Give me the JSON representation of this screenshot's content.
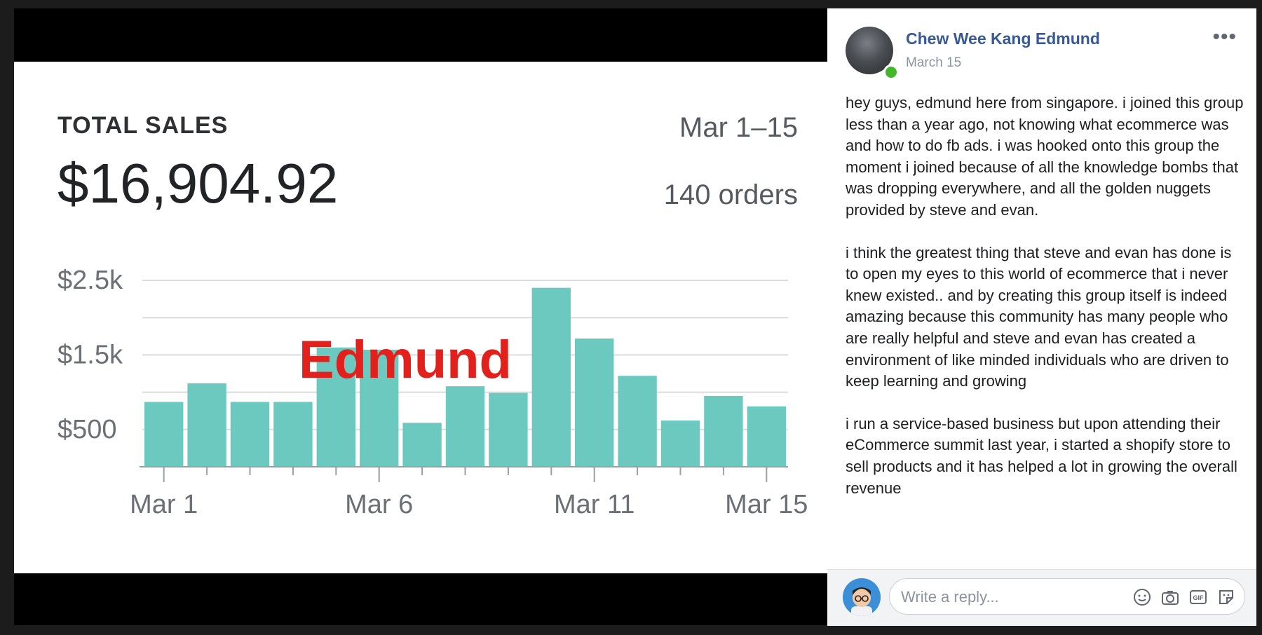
{
  "photo": {
    "label": "TOTAL SALES",
    "date_range": "Mar 1–15",
    "amount": "$16,904.92",
    "orders": "140 orders",
    "watermark": "Edmund"
  },
  "chart_data": {
    "type": "bar",
    "title": "",
    "xlabel": "",
    "ylabel": "",
    "x_tick_labels": [
      "Mar 1",
      "Mar 6",
      "Mar 11",
      "Mar 15"
    ],
    "y_tick_labels": [
      "$2.5k",
      "$1.5k",
      "$500"
    ],
    "categories": [
      "Mar 1",
      "Mar 2",
      "Mar 3",
      "Mar 4",
      "Mar 5",
      "Mar 6",
      "Mar 7",
      "Mar 8",
      "Mar 9",
      "Mar 10",
      "Mar 11",
      "Mar 12",
      "Mar 13",
      "Mar 14",
      "Mar 15"
    ],
    "values": [
      870,
      1120,
      870,
      870,
      1600,
      1570,
      590,
      1080,
      990,
      2400,
      1720,
      1220,
      620,
      950,
      810
    ],
    "ylim": [
      0,
      2500
    ],
    "grid": true,
    "bar_color": "#6cc9c0"
  },
  "post": {
    "author": "Chew Wee Kang Edmund",
    "date": "March 15",
    "more_label": "•••",
    "paragraphs": [
      "hey guys, edmund here from singapore. i joined this group less than a year ago, not knowing what ecommerce was and how to do fb ads. i was hooked onto this group the moment i joined because of all the knowledge bombs that was dropping everywhere, and all the golden nuggets provided by steve and evan.",
      "i think the greatest thing that steve and evan has done is to open my eyes to this world of ecommerce that i never knew existed.. and by creating this group itself is indeed amazing because this community has many people who are really helpful and steve and evan has created a environment of like minded individuals who are driven to keep learning and growing",
      "i run a service-based business but upon attending their eCommerce summit last year, i started a shopify store to sell products and it has helped a lot in growing the overall revenue"
    ]
  },
  "reply": {
    "placeholder": "Write a reply...",
    "icons": [
      "emoji-icon",
      "camera-icon",
      "gif-icon",
      "sticker-icon"
    ]
  },
  "colors": {
    "author_link": "#385898",
    "online": "#42b72a",
    "watermark": "#e2201c"
  }
}
